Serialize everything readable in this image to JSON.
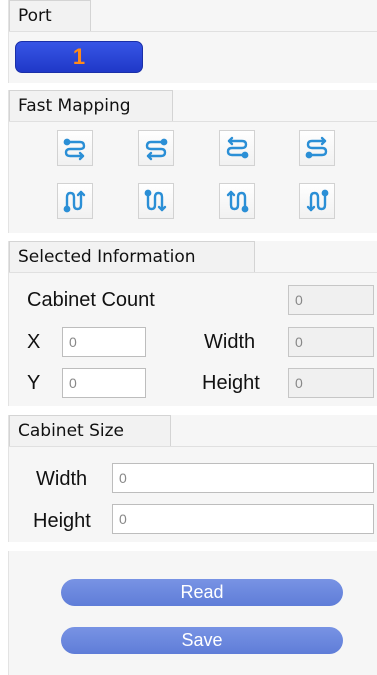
{
  "port": {
    "title": "Port",
    "number": "1"
  },
  "fast_mapping": {
    "title": "Fast Mapping",
    "buttons": [
      {
        "icon": "snake-horizontal-right-icon"
      },
      {
        "icon": "snake-horizontal-left-icon"
      },
      {
        "icon": "snake-horizontal-right-up-icon"
      },
      {
        "icon": "snake-horizontal-left-up-icon"
      },
      {
        "icon": "snake-vertical-up-icon"
      },
      {
        "icon": "snake-vertical-down-icon"
      },
      {
        "icon": "snake-vertical-up-left-icon"
      },
      {
        "icon": "snake-vertical-down-right-icon"
      }
    ]
  },
  "selected_info": {
    "title": "Selected Information",
    "cabinet_count_label": "Cabinet Count",
    "cabinet_count": "0",
    "x_label": "X",
    "x_value": "0",
    "width_label": "Width",
    "width_value": "0",
    "y_label": "Y",
    "y_value": "0",
    "height_label": "Height",
    "height_value": "0"
  },
  "cabinet_size": {
    "title": "Cabinet Size",
    "width_label": "Width",
    "width_value": "0",
    "height_label": "Height",
    "height_value": "0"
  },
  "actions": {
    "read_label": "Read",
    "save_label": "Save"
  },
  "colors": {
    "port_badge": "#2a47d8",
    "port_number": "#ff8a1a",
    "icon_blue": "#2b8fd6",
    "action_button": "#6b88de"
  }
}
